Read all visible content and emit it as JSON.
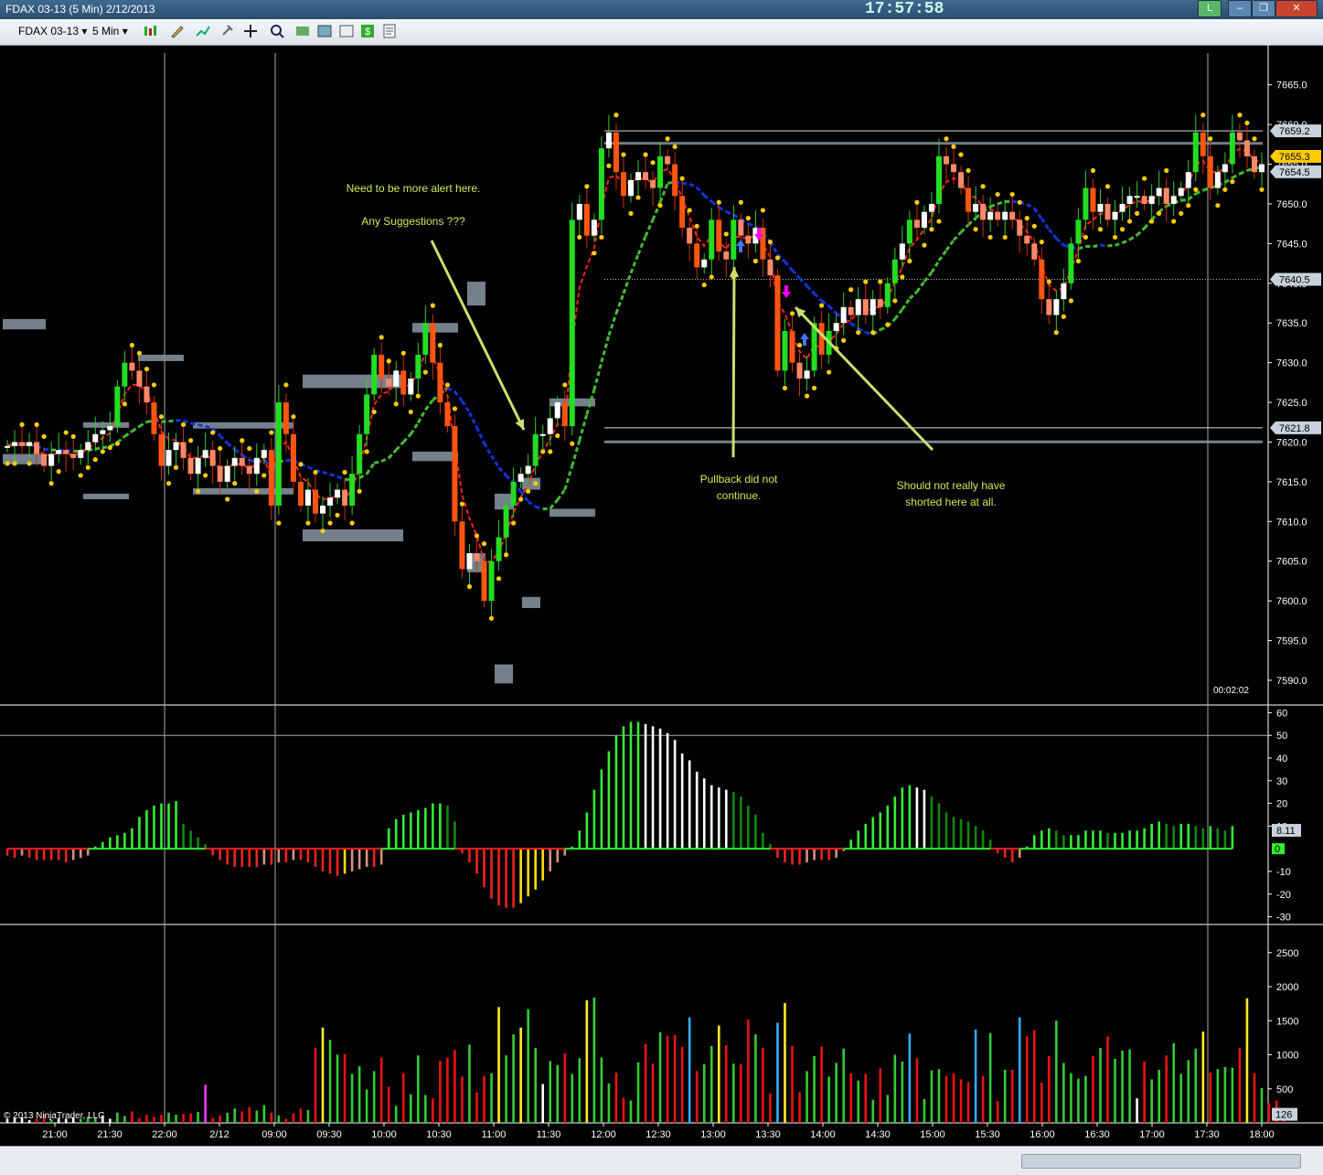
{
  "window": {
    "title": "FDAX 03-13 (5 Min)  2/12/2013",
    "clock": "17:57:58",
    "buttons": [
      "L",
      "–",
      "❐",
      "✕"
    ]
  },
  "toolbar": {
    "instrument": "FDAX 03-13",
    "interval": "5 Min",
    "icons": [
      "bar-type-icon",
      "draw-tool-icon",
      "indicator-icon",
      "pin-icon",
      "crosshair-icon",
      "zoom-icon",
      "strategy-icon",
      "properties-icon",
      "data-box-icon",
      "money-icon",
      "notes-icon"
    ]
  },
  "colors": {
    "background": "#000000",
    "bull_candle": "#22dd22",
    "bear_candle": "#ff5511",
    "zone": "#8a96a6",
    "ema_fast": "#ff2020",
    "ema_slow_up": "#44bb33",
    "ema_slow_down": "#1133dd",
    "dots": "#ffcc00",
    "annotation_text": "#ccee55",
    "annotation_arrow": "#c8e070"
  },
  "copyright": "© 2013 NinjaTrader, LLC",
  "timer": "00:02:02",
  "chart_data": [
    {
      "type": "candlestick",
      "name": "price",
      "ylim": [
        7587,
        7669
      ],
      "yticks": [
        7590.0,
        7595.0,
        7600.0,
        7605.0,
        7610.0,
        7615.0,
        7620.0,
        7625.0,
        7630.0,
        7635.0,
        7640.0,
        7645.0,
        7650.0,
        7655.0,
        7660.0,
        7665.0
      ],
      "price_markers": [
        {
          "label": "7659.2",
          "value": 7659.2
        },
        {
          "label": "7655.3",
          "value": 7655.3
        },
        {
          "label": "7654.5",
          "value": 7654.5
        },
        {
          "label": "7640.5",
          "value": 7640.5
        },
        {
          "label": "7621.8",
          "value": 7621.8
        }
      ],
      "closes": [
        7619.5,
        7620.0,
        7619.5,
        7620.0,
        7618.5,
        7617.0,
        7618.5,
        7619.0,
        7618.5,
        7618.0,
        7619.0,
        7620.0,
        7621.0,
        7621.5,
        7622.0,
        7627.0,
        7630.0,
        7629.0,
        7627.0,
        7625.0,
        7621.0,
        7617.0,
        7619.0,
        7620.0,
        7618.0,
        7616.0,
        7618.0,
        7619.0,
        7617.0,
        7615.0,
        7617.0,
        7618.0,
        7617.0,
        7616.0,
        7618.0,
        7619.0,
        7612.0,
        7625.0,
        7621.0,
        7615.0,
        7612.0,
        7614.0,
        7611.0,
        7612.0,
        7613.0,
        7614.0,
        7612.0,
        7616.0,
        7621.0,
        7626.0,
        7631.0,
        7628.0,
        7627.0,
        7629.0,
        7626.0,
        7628.0,
        7631.0,
        7635.0,
        7630.0,
        7625.0,
        7622.0,
        7610.0,
        7604.0,
        7606.0,
        7605.0,
        7600.0,
        7605.0,
        7608.0,
        7612.0,
        7615.0,
        7616.0,
        7617.0,
        7621.0,
        7621.0,
        7623.0,
        7625.0,
        7622.0,
        7648.0,
        7650.0,
        7646.0,
        7648.0,
        7657.0,
        7659.0,
        7654.0,
        7651.0,
        7653.0,
        7654.0,
        7653.0,
        7652.0,
        7656.0,
        7655.0,
        7651.0,
        7647.0,
        7645.0,
        7642.0,
        7643.0,
        7648.0,
        7644.0,
        7643.0,
        7648.0,
        7646.0,
        7645.0,
        7647.0,
        7643.0,
        7641.0,
        7629.0,
        7634.0,
        7630.0,
        7628.0,
        7629.0,
        7635.0,
        7631.0,
        7634.0,
        7635.0,
        7637.0,
        7636.0,
        7638.0,
        7636.0,
        7638.0,
        7637.0,
        7640.0,
        7643.0,
        7645.0,
        7648.0,
        7647.0,
        7649.0,
        7650.0,
        7656.0,
        7655.0,
        7654.0,
        7652.0,
        7649.0,
        7650.0,
        7648.0,
        7649.0,
        7648.0,
        7649.0,
        7648.0,
        7646.0,
        7645.0,
        7643.0,
        7638.0,
        7636.0,
        7638.0,
        7640.0,
        7645.0,
        7648.0,
        7652.0,
        7649.0,
        7650.0,
        7648.0,
        7649.0,
        7650.0,
        7651.0,
        7651.0,
        7650.0,
        7651.0,
        7652.0,
        7650.0,
        7651.0,
        7652.0,
        7654.0,
        7659.0,
        7656.0,
        7652.0,
        7654.0,
        7655.0,
        7659.0,
        7658.0,
        7656.0,
        7654.0,
        7655.0
      ]
    },
    {
      "type": "bar",
      "name": "momentum_histogram",
      "ylim": [
        -33,
        63
      ],
      "yticks": [
        60,
        50,
        40,
        30,
        20,
        10,
        -10,
        -20,
        -30
      ],
      "last_value_label": "8.11",
      "zero_label": "0",
      "values": [
        -3,
        -4,
        -3,
        -4,
        -5,
        -5,
        -5,
        -5,
        -6,
        -5,
        -4,
        -3,
        1,
        3,
        5,
        6,
        7,
        9,
        14,
        17,
        19,
        20,
        20,
        21,
        11,
        8,
        5,
        2,
        -3,
        -5,
        -7,
        -8,
        -8,
        -8,
        -8,
        -7,
        -7,
        -6,
        -6,
        -5,
        -5,
        -6,
        -8,
        -10,
        -11,
        -12,
        -11,
        -10,
        -9,
        -8,
        -8,
        -7,
        9,
        13,
        15,
        16,
        17,
        18,
        20,
        20,
        19,
        12,
        -2,
        -6,
        -11,
        -17,
        -22,
        -25,
        -26,
        -26,
        -24,
        -21,
        -18,
        -14,
        -10,
        -6,
        -3,
        1,
        8,
        16,
        26,
        35,
        43,
        50,
        54,
        56,
        56,
        55,
        54,
        53,
        51,
        48,
        42,
        39,
        34,
        31,
        28,
        27,
        26,
        25,
        23,
        19,
        15,
        7,
        2,
        -4,
        -6,
        -7,
        -7,
        -6,
        -5,
        -5,
        -5,
        -4,
        -1,
        4,
        8,
        11,
        14,
        16,
        19,
        23,
        27,
        28,
        27,
        26,
        23,
        20,
        16,
        14,
        13,
        12,
        10,
        8,
        4,
        -2,
        -4,
        -6,
        -4,
        1,
        6,
        8,
        9,
        8,
        6,
        6,
        6,
        8,
        8,
        8,
        7,
        7,
        7,
        8,
        8,
        9,
        11,
        12,
        11,
        10,
        11,
        11,
        10,
        9,
        10,
        9,
        8,
        10
      ]
    },
    {
      "type": "bar",
      "name": "volume",
      "ylim": [
        0,
        2900
      ],
      "yticks": [
        500,
        1000,
        1500,
        2000,
        2500
      ],
      "last_value_label": "126",
      "values": [
        60,
        70,
        80,
        40,
        60,
        120,
        50,
        70,
        60,
        80,
        60,
        90,
        80,
        110,
        60,
        150,
        100,
        170,
        70,
        120,
        90,
        120,
        150,
        120,
        130,
        140,
        160,
        560,
        70,
        110,
        150,
        210,
        170,
        230,
        180,
        260,
        150,
        110,
        60,
        140,
        210,
        190,
        1100,
        1400,
        1220,
        1000,
        1010,
        720,
        830,
        490,
        760,
        960,
        530,
        250,
        730,
        420,
        990,
        410,
        360,
        910,
        960,
        1070,
        680,
        1150,
        450,
        690,
        730,
        1700,
        990,
        1300,
        1400,
        1670,
        1100,
        570,
        910,
        850,
        1020,
        720,
        950,
        1800,
        1840,
        960,
        580,
        740,
        370,
        330,
        890,
        1160,
        870,
        1330,
        1280,
        1290,
        1120,
        1550,
        760,
        860,
        1130,
        1430,
        1140,
        870,
        860,
        1520,
        1300,
        1100,
        430,
        1470,
        1760,
        1130,
        450,
        760,
        980,
        1120,
        680,
        880,
        1090,
        730,
        620,
        720,
        340,
        800,
        410,
        1000,
        900,
        1310,
        950,
        350,
        770,
        790,
        690,
        730,
        640,
        600,
        1370,
        690,
        1320,
        320,
        780,
        780,
        1550,
        1270,
        1360,
        590,
        980,
        1500,
        880,
        730,
        650,
        690,
        980,
        1100,
        1270,
        940,
        1060,
        1080,
        360,
        900,
        640,
        780,
        990,
        1170,
        720,
        920,
        1090,
        1340,
        740,
        790,
        820,
        810,
        1100,
        1830,
        730,
        510,
        290,
        330,
        210
      ]
    }
  ],
  "x_axis": {
    "labels": [
      "21:00",
      "21:30",
      "22:00",
      "2/12",
      "09:00",
      "09:30",
      "10:00",
      "10:30",
      "11:00",
      "11:30",
      "12:00",
      "12:30",
      "13:00",
      "13:30",
      "14:00",
      "14:30",
      "15:00",
      "15:30",
      "16:00",
      "16:30",
      "17:00",
      "17:30",
      "18:00"
    ]
  },
  "annotations": [
    {
      "text": "Need to be more alert here."
    },
    {
      "text": "Any Suggestions ???"
    },
    {
      "text": "Pullback did not",
      "text2": "continue."
    },
    {
      "text": "Should not really have",
      "text2": "shorted here at all."
    }
  ]
}
